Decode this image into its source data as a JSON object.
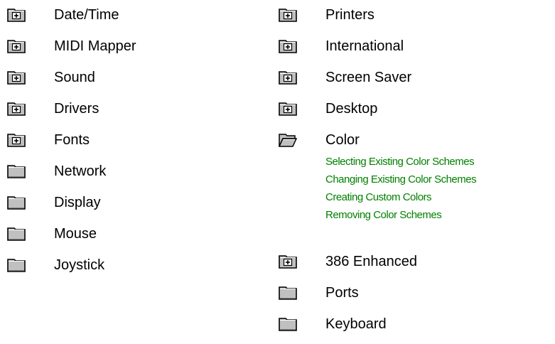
{
  "left_column": [
    {
      "label": "Date/Time",
      "icon": "folder-plus-icon"
    },
    {
      "label": "MIDI Mapper",
      "icon": "folder-plus-icon"
    },
    {
      "label": "Sound",
      "icon": "folder-plus-icon"
    },
    {
      "label": "Drivers",
      "icon": "folder-plus-icon"
    },
    {
      "label": "Fonts",
      "icon": "folder-plus-icon"
    },
    {
      "label": "Network",
      "icon": "folder-icon"
    },
    {
      "label": "Display",
      "icon": "folder-icon"
    },
    {
      "label": "Mouse",
      "icon": "folder-icon"
    },
    {
      "label": "Joystick",
      "icon": "folder-icon"
    }
  ],
  "right_column": {
    "before": [
      {
        "label": "Printers",
        "icon": "folder-plus-icon"
      },
      {
        "label": "International",
        "icon": "folder-plus-icon"
      },
      {
        "label": "Screen Saver",
        "icon": "folder-plus-icon"
      },
      {
        "label": "Desktop",
        "icon": "folder-plus-icon"
      },
      {
        "label": "Color",
        "icon": "open-folder-icon"
      }
    ],
    "color_subtopics": [
      "Selecting Existing Color Schemes",
      "Changing Existing Color Schemes",
      "Creating Custom Colors",
      "Removing Color Schemes"
    ],
    "after": [
      {
        "label": "386 Enhanced",
        "icon": "folder-plus-icon"
      },
      {
        "label": "Ports",
        "icon": "folder-icon"
      },
      {
        "label": "Keyboard",
        "icon": "folder-icon"
      }
    ]
  },
  "colors": {
    "link_green": "#008000",
    "folder_fill": "#c0c0c0",
    "folder_outline": "#000000"
  }
}
